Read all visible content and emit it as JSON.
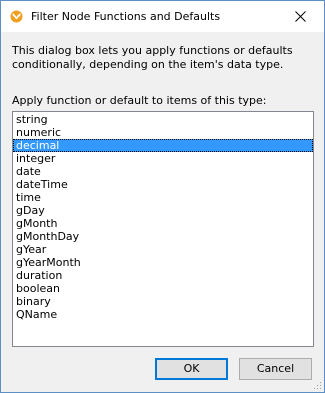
{
  "window": {
    "title": "Filter Node Functions and Defaults"
  },
  "dialog": {
    "description": "This dialog box lets you apply functions or defaults\nconditionally, depending on the item's data type.",
    "list_label": "Apply function or default to items of this type:",
    "selected_item": "decimal",
    "items": [
      "string",
      "numeric",
      "decimal",
      "integer",
      "date",
      "dateTime",
      "time",
      "gDay",
      "gMonth",
      "gMonthDay",
      "gYear",
      "gYearMonth",
      "duration",
      "boolean",
      "binary",
      "QName"
    ]
  },
  "buttons": {
    "ok_label": "OK",
    "cancel_label": "Cancel"
  },
  "colors": {
    "selection": "#3399ff",
    "title_icon": "#f0a020",
    "window_border": "#5e8fc4"
  }
}
